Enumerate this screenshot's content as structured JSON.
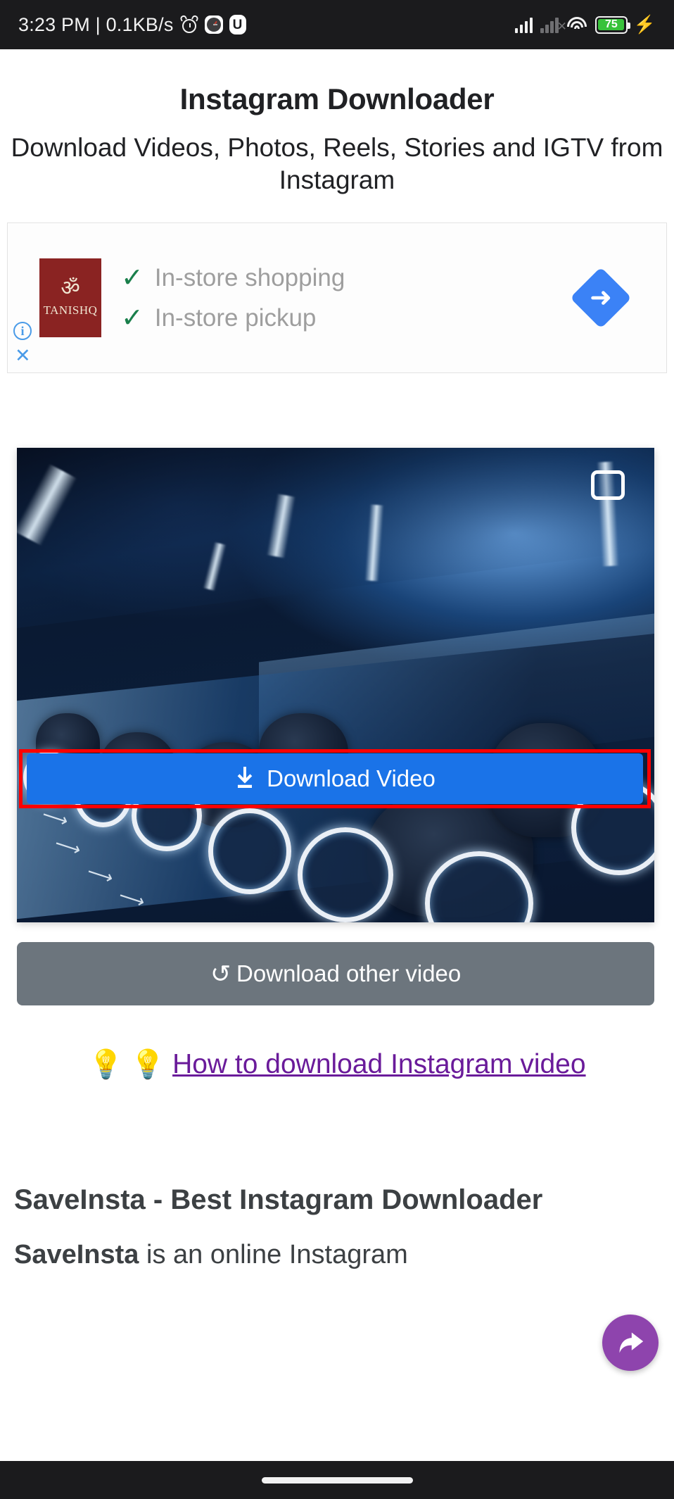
{
  "status_bar": {
    "time": "3:23 PM | 0.1KB/s",
    "icons": [
      "alarm-icon",
      "clock-app-icon",
      "u-app-icon"
    ],
    "signal_primary": "signal-full-icon",
    "signal_secondary": "signal-no-sim-icon",
    "no_sim_mark": "x",
    "wifi": "wifi-icon",
    "battery_percent": "75",
    "charging": "charging-bolt-icon",
    "background": "#1b1b1d"
  },
  "header": {
    "title": "Instagram Downloader",
    "subtitle": "Download Videos, Photos, Reels, Stories and IGTV from Instagram"
  },
  "ad": {
    "advertiser": "TANISHQ",
    "logo_glyph": "ॐ",
    "logo_color": "#8a2322",
    "rows": [
      {
        "check": "✓",
        "label": "In-store shopping"
      },
      {
        "check": "✓",
        "label": "In-store pickup"
      }
    ],
    "directions_icon": "directions-arrow-icon",
    "directions_color": "#3b82f6",
    "info_icon": "i",
    "close_icon": "✕"
  },
  "video_card": {
    "badge_icon": "video-frame-icon",
    "alt": "TRON Lightcycle ride riders in blue-lit queue",
    "download_button": {
      "label": "Download Video",
      "icon": "download-icon",
      "color": "#1a73e8",
      "highlight_color": "#ff0000"
    }
  },
  "secondary_button": {
    "label": "Download other video",
    "icon": "reload-icon",
    "color": "#6c757d"
  },
  "how_to": {
    "bulb_left": "💡",
    "bulb_right": "💡",
    "link_text": "How to download Instagram video",
    "link_color": "#6a1b9a"
  },
  "fab": {
    "icon": "share-arrow-icon",
    "color": "#8e44ad"
  },
  "article": {
    "heading": "SaveInsta - Best Instagram Downloader",
    "paragraph_brand": "SaveInsta",
    "paragraph_rest": " is an online Instagram"
  },
  "nav_bar": {
    "home_indicator": "home-indicator",
    "background": "#1b1b1d"
  }
}
